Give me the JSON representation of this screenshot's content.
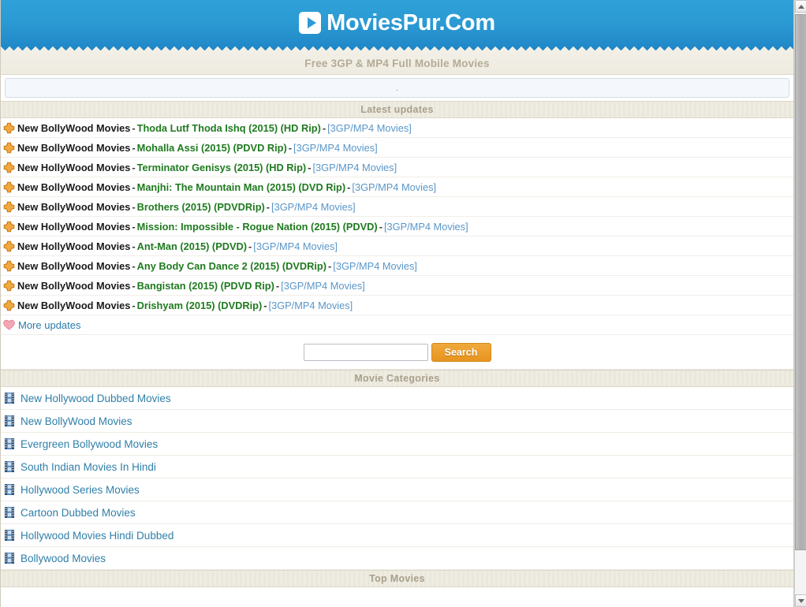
{
  "site": {
    "logo_text": "MoviesPur.Com",
    "logo_icon": "play-triangle-icon",
    "tagline": "Free 3GP & MP4 Full Mobile Movies",
    "ad_placeholder_text": "."
  },
  "sections": {
    "latest_updates_title": "Latest updates",
    "movie_categories_title": "Movie Categories",
    "top_movies_title": "Top Movies"
  },
  "latest_updates": {
    "bullet_icon": "orange-cross-icon",
    "items": [
      {
        "category": "New BollyWood Movies",
        "dash": "-",
        "title": "Thoda Lutf Thoda Ishq (2015) (HD Rip)",
        "dash2": "-",
        "format": "[3GP/MP4 Movies]"
      },
      {
        "category": "New BollyWood Movies",
        "dash": "-",
        "title": "Mohalla Assi (2015) (PDVD Rip)",
        "dash2": "-",
        "format": "[3GP/MP4 Movies]"
      },
      {
        "category": "New HollyWood Movies",
        "dash": "-",
        "title": "Terminator Genisys (2015) (HD Rip)",
        "dash2": "-",
        "format": "[3GP/MP4 Movies]"
      },
      {
        "category": "New BollyWood Movies",
        "dash": "-",
        "title": "Manjhi: The Mountain Man (2015) (DVD Rip)",
        "dash2": "-",
        "format": "[3GP/MP4 Movies]"
      },
      {
        "category": "New BollyWood Movies",
        "dash": "-",
        "title": "Brothers (2015) (PDVDRip)",
        "dash2": "-",
        "format": "[3GP/MP4 Movies]"
      },
      {
        "category": "New HollyWood Movies",
        "dash": "-",
        "title": "Mission: Impossible - Rogue Nation (2015) (PDVD)",
        "dash2": "-",
        "format": "[3GP/MP4 Movies]"
      },
      {
        "category": "New HollyWood Movies",
        "dash": "-",
        "title": "Ant-Man (2015) (PDVD)",
        "dash2": "-",
        "format": "[3GP/MP4 Movies]"
      },
      {
        "category": "New BollyWood Movies",
        "dash": "-",
        "title": "Any Body Can Dance 2 (2015) (DVDRip)",
        "dash2": "-",
        "format": "[3GP/MP4 Movies]"
      },
      {
        "category": "New BollyWood Movies",
        "dash": "-",
        "title": "Bangistan (2015) (PDVD Rip)",
        "dash2": "-",
        "format": "[3GP/MP4 Movies]"
      },
      {
        "category": "New BollyWood Movies",
        "dash": "-",
        "title": "Drishyam (2015) (DVDRip)",
        "dash2": "-",
        "format": "[3GP/MP4 Movies]"
      }
    ],
    "more_link_label": "More updates",
    "more_link_icon": "pink-heart-icon"
  },
  "search": {
    "input_value": "",
    "input_placeholder": "",
    "button_label": "Search"
  },
  "categories": {
    "icon": "film-strip-icon",
    "items": [
      {
        "label": "New Hollywood Dubbed Movies"
      },
      {
        "label": "New BollyWood Movies"
      },
      {
        "label": "Evergreen Bollywood Movies"
      },
      {
        "label": "South Indian Movies In Hindi"
      },
      {
        "label": "Hollywood Series Movies"
      },
      {
        "label": "Cartoon Dubbed Movies"
      },
      {
        "label": "Hollywood Movies Hindi Dubbed"
      },
      {
        "label": "Bollywood Movies"
      }
    ]
  },
  "colors": {
    "header_blue_top": "#2fa0d8",
    "header_blue_bottom": "#1f85c6",
    "beige": "#f2efe6",
    "section_text": "#a8a08b",
    "movie_title_green": "#1f7a1f",
    "format_link_blue": "#5a96c8",
    "category_link_blue": "#2f7fa8",
    "search_button_orange": "#e8941f",
    "bullet_orange": "#e08a24",
    "heart_pink": "#f19ba8"
  },
  "scrollbar": {
    "up_arrow_icon": "chevron-up-icon",
    "down_arrow_icon": "chevron-down-icon"
  }
}
